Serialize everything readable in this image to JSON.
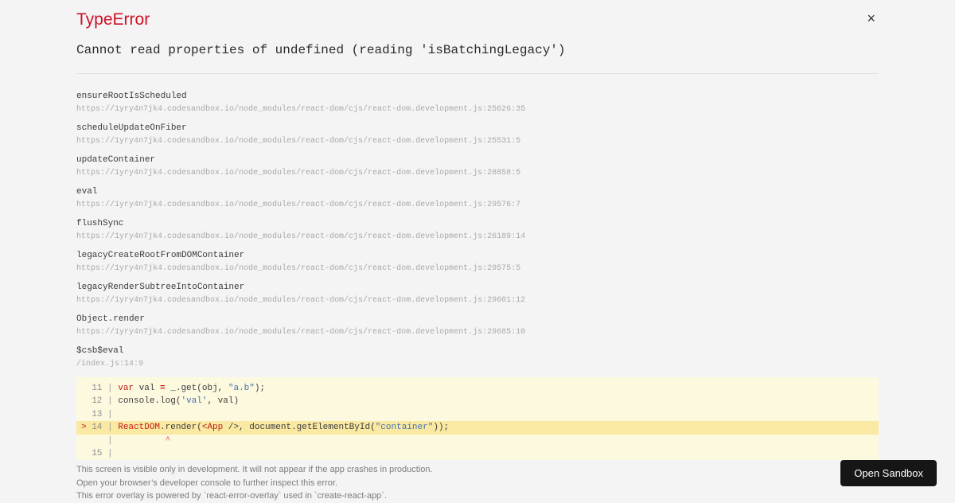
{
  "overlay": {
    "title": "TypeError",
    "message": "Cannot read properties of undefined (reading 'isBatchingLegacy')",
    "close_label": "×"
  },
  "stack": [
    {
      "fn": "ensureRootIsScheduled",
      "loc": "https://1yry4n7jk4.codesandbox.io/node_modules/react-dom/cjs/react-dom.development.js:25626:35"
    },
    {
      "fn": "scheduleUpdateOnFiber",
      "loc": "https://1yry4n7jk4.codesandbox.io/node_modules/react-dom/cjs/react-dom.development.js:25531:5"
    },
    {
      "fn": "updateContainer",
      "loc": "https://1yry4n7jk4.codesandbox.io/node_modules/react-dom/cjs/react-dom.development.js:28858:5"
    },
    {
      "fn": "eval",
      "loc": "https://1yry4n7jk4.codesandbox.io/node_modules/react-dom/cjs/react-dom.development.js:29576:7"
    },
    {
      "fn": "flushSync",
      "loc": "https://1yry4n7jk4.codesandbox.io/node_modules/react-dom/cjs/react-dom.development.js:26189:14"
    },
    {
      "fn": "legacyCreateRootFromDOMContainer",
      "loc": "https://1yry4n7jk4.codesandbox.io/node_modules/react-dom/cjs/react-dom.development.js:29575:5"
    },
    {
      "fn": "legacyRenderSubtreeIntoContainer",
      "loc": "https://1yry4n7jk4.codesandbox.io/node_modules/react-dom/cjs/react-dom.development.js:29601:12"
    },
    {
      "fn": "Object.render",
      "loc": "https://1yry4n7jk4.codesandbox.io/node_modules/react-dom/cjs/react-dom.development.js:29685:10"
    },
    {
      "fn": "$csb$eval",
      "loc": "/index.js:14:9"
    }
  ],
  "code_frame": {
    "lines": [
      {
        "marker": "",
        "num": "11",
        "highlight": false,
        "tokens": [
          {
            "t": "var",
            "c": "kw"
          },
          {
            "t": " val ",
            "c": "pl"
          },
          {
            "t": "=",
            "c": "op"
          },
          {
            "t": " _.get(obj, ",
            "c": "pl"
          },
          {
            "t": "\"a.b\"",
            "c": "str"
          },
          {
            "t": ");",
            "c": "pl"
          }
        ]
      },
      {
        "marker": "",
        "num": "12",
        "highlight": false,
        "tokens": [
          {
            "t": "console.log(",
            "c": "pl"
          },
          {
            "t": "'val'",
            "c": "str"
          },
          {
            "t": ", val)",
            "c": "pl"
          }
        ]
      },
      {
        "marker": "",
        "num": "13",
        "highlight": false,
        "tokens": []
      },
      {
        "marker": ">",
        "num": "14",
        "highlight": true,
        "tokens": [
          {
            "t": "ReactDOM",
            "c": "kw"
          },
          {
            "t": ".render(",
            "c": "pl"
          },
          {
            "t": "<App",
            "c": "kw"
          },
          {
            "t": " />, document.getElementById(",
            "c": "pl"
          },
          {
            "t": "\"container\"",
            "c": "str"
          },
          {
            "t": "));",
            "c": "pl"
          }
        ]
      },
      {
        "marker": "",
        "num": "",
        "highlight": false,
        "tokens": [
          {
            "t": "         ",
            "c": "pl"
          },
          {
            "t": "^",
            "c": "caret"
          }
        ]
      },
      {
        "marker": "",
        "num": "15",
        "highlight": false,
        "tokens": []
      }
    ]
  },
  "footer": {
    "lines": [
      "This screen is visible only in development. It will not appear if the app crashes in production.",
      "Open your browser’s developer console to further inspect this error.",
      "This error overlay is powered by `react-error-overlay` used in `create-react-app`."
    ],
    "open_sandbox_label": "Open Sandbox"
  },
  "colors": {
    "background": "#f4f4f4",
    "error_red": "#ce1126",
    "code_background": "#fcf9df",
    "code_highlight_line": "#fae9a2",
    "code_keyword": "#c41a16",
    "code_string": "#4271ae",
    "button_background": "#161616",
    "button_text": "#ffffff"
  }
}
